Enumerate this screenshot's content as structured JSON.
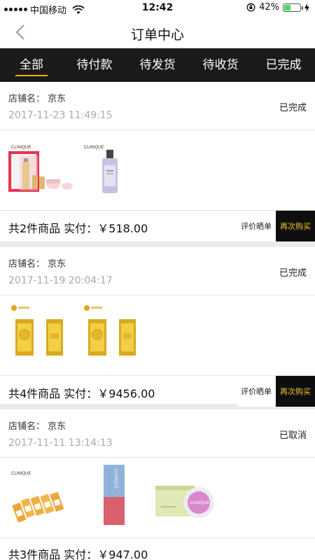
{
  "status_bar": {
    "carrier": "中国移动",
    "time": "12:42",
    "battery_percent": "42%",
    "battery_level": 0.42,
    "icons": [
      "signal-dots-icon",
      "wifi-icon",
      "orientation-lock-icon",
      "battery-icon",
      "charging-icon"
    ]
  },
  "nav": {
    "title": "订单中心",
    "back_icon": "chevron-left-icon"
  },
  "tabs": [
    {
      "label": "全部",
      "active": true
    },
    {
      "label": "待付款",
      "active": false
    },
    {
      "label": "待发货",
      "active": false
    },
    {
      "label": "待收货",
      "active": false
    },
    {
      "label": "已完成",
      "active": false
    }
  ],
  "orders": [
    {
      "store": "店铺名：  京东",
      "time": "2017-11-23 11:49:15",
      "status": "已完成",
      "total": "共2件商品  实付：￥518.00",
      "actions": {
        "review": "评价晒单",
        "rebuy": "再次购买"
      },
      "products": [
        {
          "name": "clinique-gift-set",
          "brand_text": "CLINIQUE"
        },
        {
          "name": "clinique-toner-bottle",
          "brand_text": "CLINIQUE"
        }
      ]
    },
    {
      "store": "店铺名：  京东",
      "time": "2017-11-19 20:04:17",
      "status": "已完成",
      "total": "共4件商品  实付：￥9456.00",
      "actions": {
        "review": "评价晒单",
        "rebuy": "再次购买"
      },
      "products": [
        {
          "name": "gold-bar-pair",
          "brand_text": ""
        },
        {
          "name": "gold-bar-pair",
          "brand_text": ""
        }
      ]
    },
    {
      "store": "店铺名：  京东",
      "time": "2017-11-11 13:14:13",
      "status": "已取消",
      "total": "共3件商品  实付：￥947.00",
      "products": [
        {
          "name": "clinique-sample-packets",
          "brand_text": "CLINIQUE"
        },
        {
          "name": "clinique-lipstick",
          "brand_text": "CLINIQUE"
        },
        {
          "name": "clinique-blush-compact",
          "brand_text": "CLINIQUE"
        }
      ]
    }
  ],
  "colors": {
    "tab_bar_bg": "#1a1a1a",
    "tab_indicator": "#e8b20b",
    "rebuy_bg": "#0e0e0e",
    "rebuy_text": "#f3c42e",
    "muted_text": "#aaaaaa",
    "page_bg": "#ebebeb"
  }
}
